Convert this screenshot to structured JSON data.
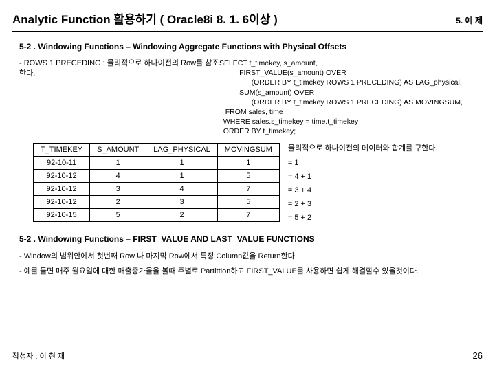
{
  "header": {
    "title": "Analytic Function 활용하기 ( Oracle8i 8. 1. 6이상 )",
    "right": "5. 예 제"
  },
  "section1": {
    "heading": "5-2 . Windowing Functions     –   Windowing Aggregate Functions with Physical Offsets",
    "left_note": "- ROWS 1 PRECEDING : 물리적으로 하나이전의 Row를 참조한다.",
    "sql": {
      "l1": "SELECT t_timekey, s_amount,",
      "l2": "          FIRST_VALUE(s_amount) OVER",
      "l3": "                (ORDER BY t_timekey ROWS 1 PRECEDING) AS LAG_physical,",
      "l4": "          SUM(s_amount) OVER",
      "l5": "                (ORDER BY t_timekey ROWS 1 PRECEDING) AS MOVINGSUM,",
      "l6": "   FROM sales, time",
      "l7": "  WHERE sales.s_timekey = time.t_timekey",
      "l8": "  ORDER BY t_timekey;"
    }
  },
  "table": {
    "headers": [
      "T_TIMEKEY",
      "S_AMOUNT",
      "LAG_PHYSICAL",
      "MOVINGSUM"
    ],
    "rows": [
      [
        "92-10-11",
        "1",
        "1",
        "1"
      ],
      [
        "92-10-12",
        "4",
        "1",
        "5"
      ],
      [
        "92-10-12",
        "3",
        "4",
        "7"
      ],
      [
        "92-10-12",
        "2",
        "3",
        "5"
      ],
      [
        "92-10-15",
        "5",
        "2",
        "7"
      ]
    ]
  },
  "side": {
    "note_top": "물리적으로 하나이전의 데이터와 합계를 구한다.",
    "eqs": [
      "= 1",
      "= 4 + 1",
      "= 3 + 4",
      "= 2 + 3",
      "= 5 + 2"
    ]
  },
  "section2": {
    "heading": "5-2 . Windowing Functions     –   FIRST_VALUE AND LAST_VALUE FUNCTIONS",
    "desc1": "- Window의 범위안에서 첫번째 Row 나 마지막 Row에서 특정 Column값을 Return한다.",
    "desc2": "- 예를 들면 매주 월요일에 대한 매출증가율을 볼때 주별로 Partittion하고 FIRST_VALUE를 사용하면 쉽게 해결할수 있을것이다."
  },
  "footer": {
    "author": "작성자 : 이 현 재",
    "page": "26"
  }
}
